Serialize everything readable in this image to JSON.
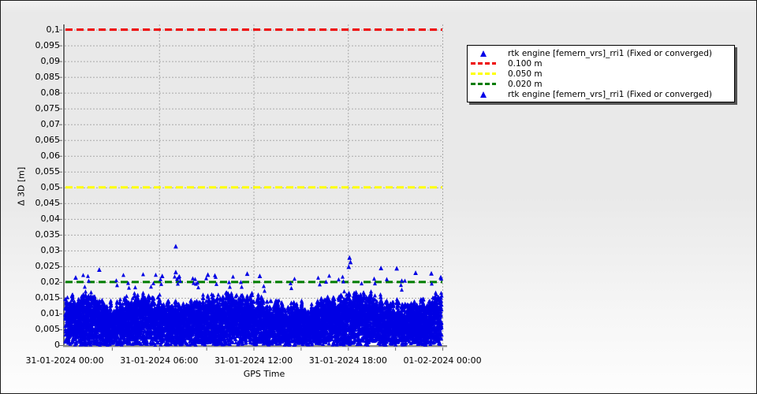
{
  "chart_data": {
    "type": "scatter",
    "title": "",
    "xlabel": "GPS Time",
    "ylabel": "Δ 3D [m]",
    "ylim": [
      0,
      0.1
    ],
    "y_tick_step": 0.005,
    "y_decimal_separator": ",",
    "grid": "dashed",
    "xlim_hours": [
      0,
      24
    ],
    "x_minor_step_hours": 3,
    "x_ticks": [
      {
        "hour": 0,
        "label": "31-01-2024 00:00"
      },
      {
        "hour": 6,
        "label": "31-01-2024 06:00"
      },
      {
        "hour": 12,
        "label": "31-01-2024 12:00"
      },
      {
        "hour": 18,
        "label": "31-01-2024 18:00"
      },
      {
        "hour": 24,
        "label": "01-02-2024 00:00"
      }
    ],
    "y_ticks": [
      {
        "v": 0,
        "label": "0"
      },
      {
        "v": 0.005,
        "label": "0,005"
      },
      {
        "v": 0.01,
        "label": "0,01"
      },
      {
        "v": 0.015,
        "label": "0,015"
      },
      {
        "v": 0.02,
        "label": "0,02"
      },
      {
        "v": 0.025,
        "label": "0,025"
      },
      {
        "v": 0.03,
        "label": "0,03"
      },
      {
        "v": 0.035,
        "label": "0,035"
      },
      {
        "v": 0.04,
        "label": "0,04"
      },
      {
        "v": 0.045,
        "label": "0,045"
      },
      {
        "v": 0.05,
        "label": "0,05"
      },
      {
        "v": 0.055,
        "label": "0,055"
      },
      {
        "v": 0.06,
        "label": "0,06"
      },
      {
        "v": 0.065,
        "label": "0,065"
      },
      {
        "v": 0.07,
        "label": "0,07"
      },
      {
        "v": 0.075,
        "label": "0,075"
      },
      {
        "v": 0.08,
        "label": "0,08"
      },
      {
        "v": 0.085,
        "label": "0,085"
      },
      {
        "v": 0.09,
        "label": "0,09"
      },
      {
        "v": 0.095,
        "label": "0,095"
      },
      {
        "v": 0.1,
        "label": "0,1"
      }
    ],
    "reference_lines": [
      {
        "value": 0.1,
        "color": "#ee0000",
        "label": "0.100 m"
      },
      {
        "value": 0.05,
        "color": "#ffff00",
        "label": "0.050 m"
      },
      {
        "value": 0.02,
        "color": "#007c00",
        "label": "0.020 m"
      }
    ],
    "series": [
      {
        "name": "rtk engine [femern_vrs]_rri1 (Fixed or converged)",
        "marker": "triangle",
        "color": "#0000e4",
        "description": "Dense high-rate Δ3D error scatter over 24 h; solid band ≈ 0 to 0.016 m, frequent small peaks to ≈0.02 m, rare outliers to 0.031 m",
        "band": {
          "typical_min": 0,
          "typical_max": 0.018
        },
        "outliers": [
          {
            "hour": 0.7,
            "value": 0.0213
          },
          {
            "hour": 2.2,
            "value": 0.0238
          },
          {
            "hour": 6.2,
            "value": 0.0218
          },
          {
            "hour": 7.06,
            "value": 0.0312
          },
          {
            "hour": 7.06,
            "value": 0.023
          },
          {
            "hour": 7.25,
            "value": 0.0214
          },
          {
            "hour": 9.1,
            "value": 0.0222
          },
          {
            "hour": 11.6,
            "value": 0.0225
          },
          {
            "hour": 12.4,
            "value": 0.0218
          },
          {
            "hour": 18.1,
            "value": 0.0276
          },
          {
            "hour": 18.16,
            "value": 0.0262
          },
          {
            "hour": 18.05,
            "value": 0.0247
          },
          {
            "hour": 20.1,
            "value": 0.0243
          },
          {
            "hour": 21.1,
            "value": 0.0242
          },
          {
            "hour": 22.3,
            "value": 0.0228
          },
          {
            "hour": 23.3,
            "value": 0.0226
          },
          {
            "hour": 23.9,
            "value": 0.0214
          }
        ],
        "sim": {
          "seed": 20240131,
          "points_per_column": 21,
          "envelope_base": 0.0128,
          "envelope_wave": 0.0016,
          "envelope_noise": 0.0026,
          "power": 0.75,
          "top_extra_prob": 0.55,
          "spike_prob": 0.09,
          "spike_min": 0.0182,
          "spike_max": 0.0224
        }
      }
    ],
    "legend": {
      "position": "top-right",
      "items": [
        {
          "marker": "triangle",
          "color": "#0000e8",
          "label": "rtk engine [femern_vrs]_rri1 (Fixed or converged)"
        },
        {
          "marker": "dash",
          "color": "#ee0000",
          "label": "0.100 m"
        },
        {
          "marker": "dash",
          "color": "#ffff00",
          "label": "0.050 m"
        },
        {
          "marker": "dash",
          "color": "#007c00",
          "label": "0.020 m"
        },
        {
          "marker": "triangle",
          "color": "#0000e8",
          "label": "rtk engine [femern_vrs]_rri1 (Fixed or converged)"
        }
      ]
    },
    "colors": {
      "marker_blue": "#0000e4",
      "ref_red": "#ee0000",
      "ref_yellow": "#ffff00",
      "ref_green": "#007c00",
      "grid": "#a9a9a9",
      "axis": "#6e6e6e",
      "tick": "#6f6f6f"
    }
  }
}
